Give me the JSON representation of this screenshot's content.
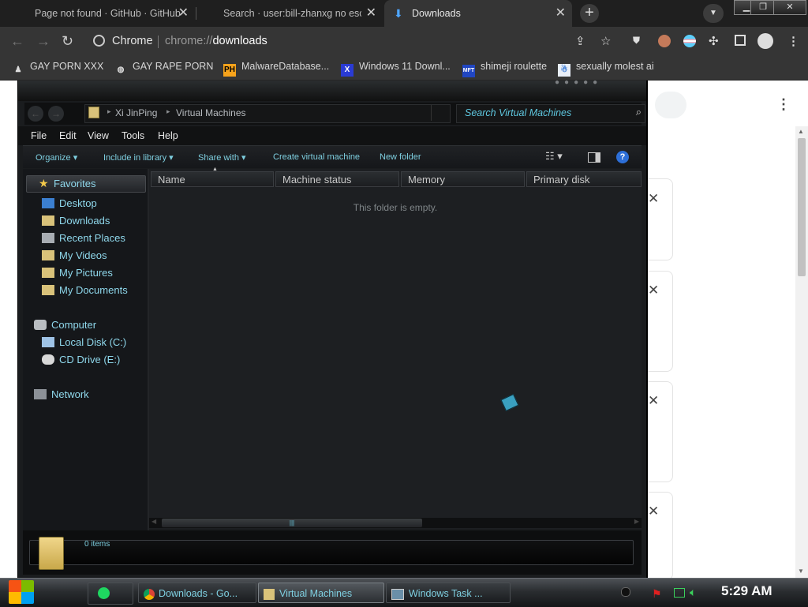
{
  "browser": {
    "tabs": [
      {
        "title": "Page not found · GitHub · GitHub",
        "active": false
      },
      {
        "title": "Search · user:bill-zhanxg no esc",
        "active": false
      },
      {
        "title": "Downloads",
        "active": true
      }
    ],
    "new_tab_label": "+",
    "omnibox": {
      "site": "Chrome",
      "url_prefix": "chrome://",
      "url_path": "downloads"
    },
    "bookmarks": [
      {
        "label": "GAY PORN XXX"
      },
      {
        "label": "GAY RAPE PORN"
      },
      {
        "label": "MalwareDatabase..."
      },
      {
        "label": "Windows 11 Downl..."
      },
      {
        "label": "shimeji roulette"
      },
      {
        "label": "sexually molest ai"
      }
    ]
  },
  "explorer": {
    "breadcrumb": [
      "Xi JinPing",
      "Virtual Machines"
    ],
    "search_placeholder": "Search Virtual Machines",
    "menu": [
      "File",
      "Edit",
      "View",
      "Tools",
      "Help"
    ],
    "commands": [
      "Organize",
      "Include in library",
      "Share with",
      "Create virtual machine",
      "New folder"
    ],
    "nav": {
      "favorites_label": "Favorites",
      "favorites": [
        "Desktop",
        "Downloads",
        "Recent Places",
        "My Videos",
        "My Pictures",
        "My Documents"
      ],
      "computer_label": "Computer",
      "drives": [
        "Local Disk (C:)",
        "CD Drive (E:)"
      ],
      "network_label": "Network"
    },
    "columns": [
      "Name",
      "Machine status",
      "Memory",
      "Primary disk"
    ],
    "empty_message": "This folder is empty.",
    "status_items": "0 items"
  },
  "taskbar": {
    "tasks": [
      {
        "label": "Downloads - Go...",
        "active": false
      },
      {
        "label": "Virtual Machines",
        "active": true
      },
      {
        "label": "Windows Task ...",
        "active": false
      }
    ],
    "clock": "5:29 AM"
  },
  "colors": {
    "accent_cyan": "#7ecfe0",
    "explorer_bg": "#1a1c1e",
    "chrome_dark": "#353535"
  }
}
